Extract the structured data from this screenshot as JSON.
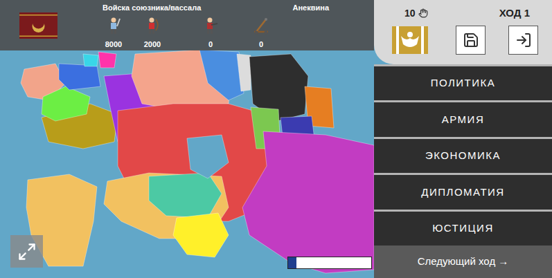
{
  "header": {
    "allied_label": "Войска союзника/вассала",
    "faction": "Анеквина",
    "units": [
      {
        "kind": "swordsman",
        "count": "8000"
      },
      {
        "kind": "archer",
        "count": "2000"
      },
      {
        "kind": "gunner",
        "count": "0"
      },
      {
        "kind": "catapult",
        "count": "0"
      }
    ]
  },
  "turn_panel": {
    "actions": "10",
    "turn": "ХОД 1"
  },
  "menu": [
    {
      "label": "ПОЛИТИКА",
      "selected": false
    },
    {
      "label": "АРМИЯ",
      "selected": false
    },
    {
      "label": "ЭКОНОМИКА",
      "selected": false
    },
    {
      "label": "ДИПЛОМАТИЯ",
      "selected": false
    },
    {
      "label": "ЮСТИЦИЯ",
      "selected": false
    }
  ],
  "next_turn": "Следующий ход →",
  "progress": {
    "level": 0.1
  },
  "map": {
    "regions": [
      {
        "color": "#f2a48a"
      },
      {
        "color": "#b89d1a"
      },
      {
        "color": "#6cee44"
      },
      {
        "color": "#3b6fe0"
      },
      {
        "color": "#9a33e0"
      },
      {
        "color": "#39d6e8"
      },
      {
        "color": "#ff33aa"
      },
      {
        "color": "#f4a48c"
      },
      {
        "color": "#4a8ee0"
      },
      {
        "color": "#dcdcdc"
      },
      {
        "color": "#2e2e2e"
      },
      {
        "color": "#e67e22"
      },
      {
        "color": "#e24848"
      },
      {
        "color": "#7cc850"
      },
      {
        "color": "#3b3bb0"
      },
      {
        "color": "#c23cc2"
      },
      {
        "color": "#f2c160"
      },
      {
        "color": "#f2c160"
      },
      {
        "color": "#4cc9a4"
      },
      {
        "color": "#fff02a"
      },
      {
        "color": "#62a7c8"
      }
    ]
  }
}
